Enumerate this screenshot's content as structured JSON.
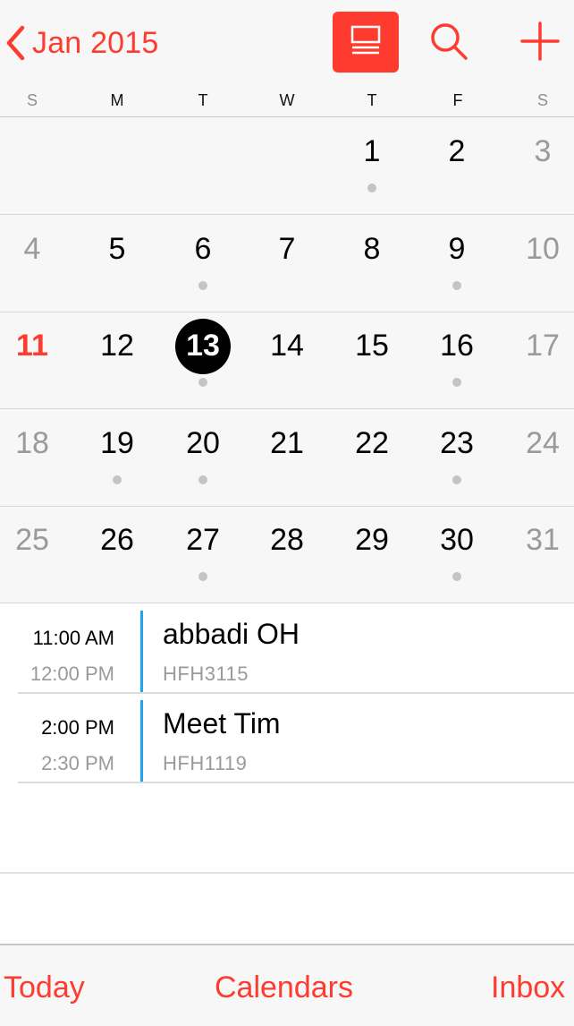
{
  "header": {
    "back_label": "Jan 2015",
    "accent": "#ff3b30",
    "icons": {
      "back": "chevron-left-icon",
      "list": "list-view-icon",
      "search": "search-icon",
      "add": "plus-icon"
    }
  },
  "weekdays": [
    "S",
    "M",
    "T",
    "W",
    "T",
    "F",
    "S"
  ],
  "month": {
    "weeks": [
      [
        {
          "n": ""
        },
        {
          "n": ""
        },
        {
          "n": ""
        },
        {
          "n": ""
        },
        {
          "n": "1",
          "dot": true
        },
        {
          "n": "2"
        },
        {
          "n": "3"
        }
      ],
      [
        {
          "n": "4"
        },
        {
          "n": "5"
        },
        {
          "n": "6",
          "dot": true
        },
        {
          "n": "7"
        },
        {
          "n": "8"
        },
        {
          "n": "9",
          "dot": true
        },
        {
          "n": "10"
        }
      ],
      [
        {
          "n": "11",
          "today": true
        },
        {
          "n": "12"
        },
        {
          "n": "13",
          "selected": true,
          "dot": true
        },
        {
          "n": "14"
        },
        {
          "n": "15"
        },
        {
          "n": "16",
          "dot": true
        },
        {
          "n": "17"
        }
      ],
      [
        {
          "n": "18"
        },
        {
          "n": "19",
          "dot": true
        },
        {
          "n": "20",
          "dot": true
        },
        {
          "n": "21"
        },
        {
          "n": "22"
        },
        {
          "n": "23",
          "dot": true
        },
        {
          "n": "24"
        }
      ],
      [
        {
          "n": "25"
        },
        {
          "n": "26"
        },
        {
          "n": "27",
          "dot": true
        },
        {
          "n": "28"
        },
        {
          "n": "29"
        },
        {
          "n": "30",
          "dot": true
        },
        {
          "n": "31"
        }
      ]
    ]
  },
  "events": [
    {
      "start": "11:00 AM",
      "end": "12:00 PM",
      "title": "abbadi OH",
      "location": "HFH3115",
      "color": "#1fa6ea"
    },
    {
      "start": "2:00 PM",
      "end": "2:30 PM",
      "title": "Meet Tim",
      "location": "HFH1119",
      "color": "#1fa6ea"
    }
  ],
  "toolbar": {
    "today": "Today",
    "calendars": "Calendars",
    "inbox": "Inbox"
  }
}
